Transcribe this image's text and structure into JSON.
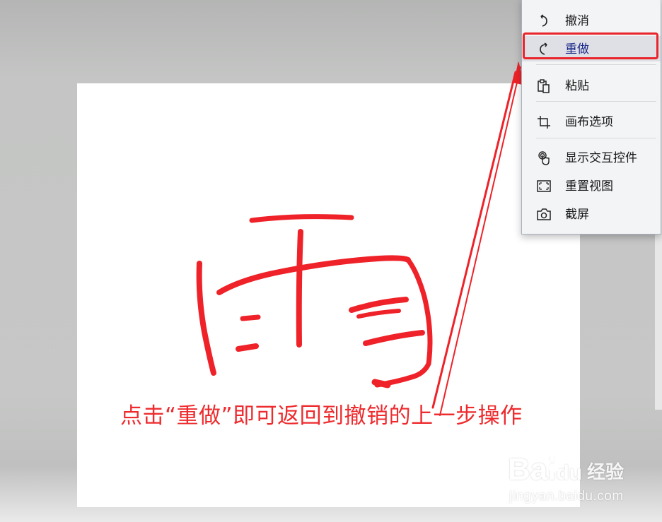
{
  "menu": {
    "items": [
      {
        "name": "undo",
        "label": "撤消",
        "icon": "undo-icon",
        "highlighted": false
      },
      {
        "name": "redo",
        "label": "重做",
        "icon": "redo-icon",
        "highlighted": true
      },
      {
        "name": "paste",
        "label": "粘贴",
        "icon": "paste-icon",
        "highlighted": false
      },
      {
        "name": "canvas-options",
        "label": "画布选项",
        "icon": "crop-icon",
        "highlighted": false
      },
      {
        "name": "show-interactive-controls",
        "label": "显示交互控件",
        "icon": "touch-icon",
        "highlighted": false
      },
      {
        "name": "reset-view",
        "label": "重置视图",
        "icon": "fit-view-icon",
        "highlighted": false
      },
      {
        "name": "screenshot",
        "label": "截屏",
        "icon": "camera-icon",
        "highlighted": false
      }
    ]
  },
  "annotation": {
    "caption": "点击“重做”即可返回到撤销的上一步操作",
    "color": "#ee2b2e"
  },
  "drawing": {
    "ink_color": "#ee2228",
    "description_hidden": true
  },
  "watermark": {
    "brand": "Bai",
    "brand_suffix": "du",
    "site": "经验",
    "url": "jingyan.baidu.com"
  },
  "colors": {
    "highlight_border": "#e9252b",
    "menu_bg": "#f3f4f6"
  }
}
